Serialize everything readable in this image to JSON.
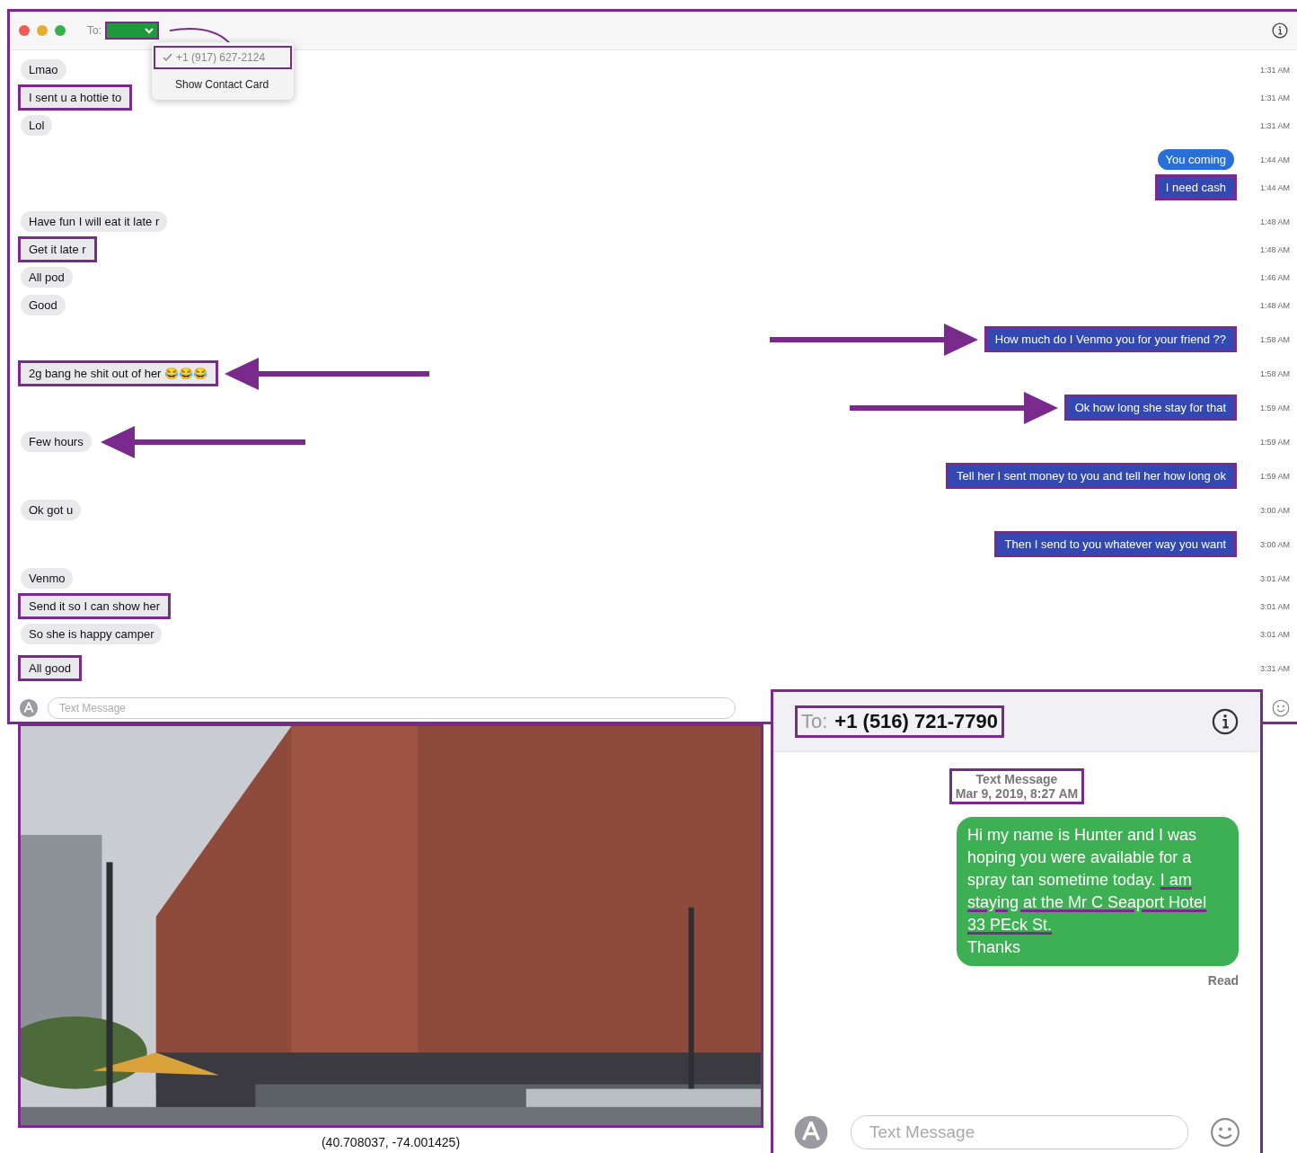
{
  "window": {
    "recipient_label": "To:",
    "contact_menu": {
      "items": [
        {
          "label": "+1 (917) 627-2124",
          "checked": true,
          "highlighted": true
        },
        {
          "label": "Show Contact Card",
          "checked": false,
          "highlighted": false
        }
      ]
    }
  },
  "messages": [
    {
      "text": "Lmao",
      "outgoing": false,
      "time": "1:31 AM",
      "highlighted": false,
      "arrow": false
    },
    {
      "text": "I sent u a hottie to",
      "outgoing": false,
      "time": "1:31 AM",
      "highlighted": true,
      "arrow": false
    },
    {
      "text": "Lol",
      "outgoing": false,
      "time": "1:31 AM",
      "highlighted": false,
      "arrow": false
    },
    {
      "text": "You coming",
      "outgoing": true,
      "time": "1:44 AM",
      "highlighted": false,
      "arrow": false
    },
    {
      "text": "I need cash",
      "outgoing": true,
      "time": "1:44 AM",
      "highlighted": true,
      "arrow": false
    },
    {
      "text": "Have fun I will eat it late r",
      "outgoing": false,
      "time": "1:48 AM",
      "highlighted": false,
      "arrow": false
    },
    {
      "text": "Get it late r",
      "outgoing": false,
      "time": "1:48 AM",
      "highlighted": true,
      "arrow": false
    },
    {
      "text": "All pod",
      "outgoing": false,
      "time": "1:46 AM",
      "highlighted": false,
      "arrow": false
    },
    {
      "text": "Good",
      "outgoing": false,
      "time": "1:48 AM",
      "highlighted": false,
      "arrow": false
    },
    {
      "text": "How much do I Venmo you for your friend ??",
      "outgoing": true,
      "time": "1:58 AM",
      "highlighted": true,
      "arrow": true
    },
    {
      "text": "2g bang he shit out of her 😂😂😂",
      "outgoing": false,
      "time": "1:58 AM",
      "highlighted": true,
      "arrow": true
    },
    {
      "text": "Ok how long she stay for that",
      "outgoing": true,
      "time": "1:59 AM",
      "highlighted": true,
      "arrow": true
    },
    {
      "text": "Few hours",
      "outgoing": false,
      "time": "1:59 AM",
      "highlighted": false,
      "arrow": true
    },
    {
      "text": "Tell her I sent money to you and tell her how long ok",
      "outgoing": true,
      "time": "1:59 AM",
      "highlighted": true,
      "arrow": false
    },
    {
      "text": "Ok got u",
      "outgoing": false,
      "time": "3:00 AM",
      "highlighted": false,
      "arrow": false
    },
    {
      "text": "Then I send to you whatever way you want",
      "outgoing": true,
      "time": "3:00 AM",
      "highlighted": true,
      "arrow": false
    },
    {
      "text": "Venmo",
      "outgoing": false,
      "time": "3:01 AM",
      "highlighted": false,
      "arrow": false
    },
    {
      "text": "Send it so I can show her",
      "outgoing": false,
      "time": "3:01 AM",
      "highlighted": true,
      "arrow": false
    },
    {
      "text": "So she is happy camper",
      "outgoing": false,
      "time": "3:01 AM",
      "highlighted": false,
      "arrow": false
    },
    {
      "text": "All good",
      "outgoing": false,
      "time": "3:31 AM",
      "highlighted": true,
      "arrow": false
    }
  ],
  "composer": {
    "placeholder": "Text Message"
  },
  "phone": {
    "to_label": "To:",
    "to": "+1 (516) 721-7790",
    "service": "Text Message",
    "timestamp": "Mar 9, 2019, 8:27 AM",
    "bubble": {
      "before": "Hi my name is Hunter and I was hoping you were available for a spray tan sometime today. ",
      "underlined": "I am staying at the Mr C Seaport Hotel 33 PEck St.",
      "after": "\nThanks"
    },
    "status": "Read",
    "composer": {
      "placeholder": "Text Message"
    }
  },
  "caption": "(40.708037, -74.001425)"
}
